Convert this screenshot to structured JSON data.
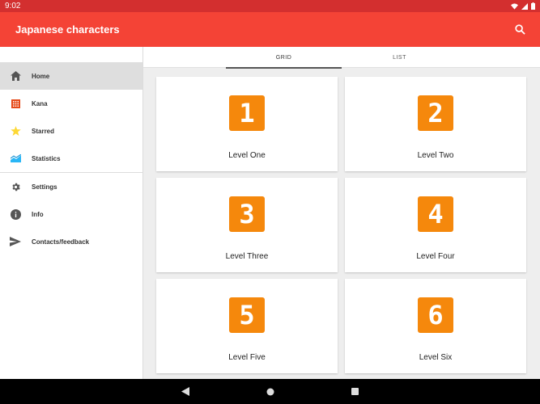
{
  "status": {
    "time": "9:02"
  },
  "app": {
    "title": "Japanese characters"
  },
  "drawer": {
    "items": [
      {
        "label": "Home",
        "icon": "home-icon"
      },
      {
        "label": "Kana",
        "icon": "grid-icon"
      },
      {
        "label": "Starred",
        "icon": "star-icon"
      },
      {
        "label": "Statistics",
        "icon": "chart-icon"
      },
      {
        "label": "Settings",
        "icon": "gear-icon"
      },
      {
        "label": "Info",
        "icon": "info-icon"
      },
      {
        "label": "Contacts/feedback",
        "icon": "send-icon"
      }
    ]
  },
  "tabs": [
    {
      "label": "GRID"
    },
    {
      "label": "LIST"
    }
  ],
  "levels": [
    {
      "number": "1",
      "label": "Level One"
    },
    {
      "number": "2",
      "label": "Level Two"
    },
    {
      "number": "3",
      "label": "Level Three"
    },
    {
      "number": "4",
      "label": "Level Four"
    },
    {
      "number": "5",
      "label": "Level Five"
    },
    {
      "number": "6",
      "label": "Level Six"
    }
  ],
  "colors": {
    "app_bar": "#f44336",
    "status_bar": "#d32f2f",
    "badge": "#f5880c",
    "star": "#fdd835",
    "kana": "#e64a19",
    "stats": "#29b6f6"
  }
}
